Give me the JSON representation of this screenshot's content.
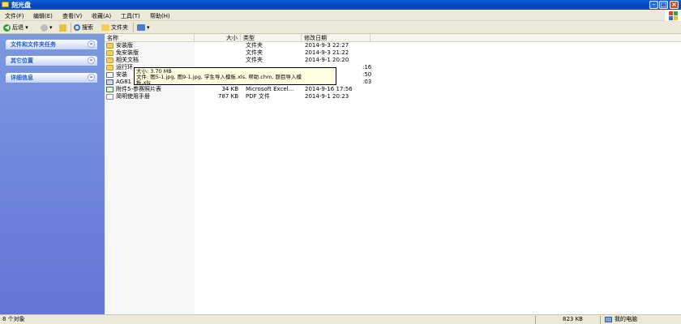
{
  "window": {
    "title": "刻光盘"
  },
  "menu": [
    "文件(F)",
    "编辑(E)",
    "查看(V)",
    "收藏(A)",
    "工具(T)",
    "帮助(H)"
  ],
  "toolbar": {
    "back": "后退",
    "search": "搜索",
    "folders": "文件夹"
  },
  "taskpane": {
    "panels": [
      "文件和文件夹任务",
      "其它位置",
      "详细信息"
    ],
    "chevron": "»"
  },
  "columns": {
    "name": "名称",
    "size": "大小",
    "type": "类型",
    "modified": "修改日期"
  },
  "files": [
    {
      "name": "安装版",
      "size": "",
      "type": "文件夹",
      "modified": "2014-9-3 22:27",
      "icon": "folder-icon"
    },
    {
      "name": "免安装版",
      "size": "",
      "type": "文件夹",
      "modified": "2014-9-3 21:22",
      "icon": "folder-icon"
    },
    {
      "name": "相关文档",
      "size": "",
      "type": "文件夹",
      "modified": "2014-9-1 20:20",
      "icon": "folder-icon"
    },
    {
      "name": "运行环",
      "size": "",
      "type": "",
      "modified": ":16",
      "icon": "folder-icon"
    },
    {
      "name": "安装",
      "size": "",
      "type": "",
      "modified": ":50",
      "icon": "doc-icon"
    },
    {
      "name": "AG81",
      "size": "",
      "type": "",
      "modified": ":03",
      "icon": "app-icon"
    },
    {
      "name": "附件5-参赛照片表",
      "size": "34 KB",
      "type": "Microsoft Excel...",
      "modified": "2014-9-16 17:56",
      "icon": "excel-icon"
    },
    {
      "name": "简明使用手册",
      "size": "787 KB",
      "type": "PDF 文件",
      "modified": "2014-9-1 20:23",
      "icon": "pdf-icon"
    }
  ],
  "tooltip": {
    "line1": "大小: 3.70 MB",
    "line2": "文件: 图5-1.jpg, 图9-1.jpg, 学生导入模板.xls, 帮助.chm, 题目导入模",
    "line3": "板.xls"
  },
  "status": {
    "objects": "8 个对象",
    "size": "823 KB",
    "location": "我的电脑"
  }
}
